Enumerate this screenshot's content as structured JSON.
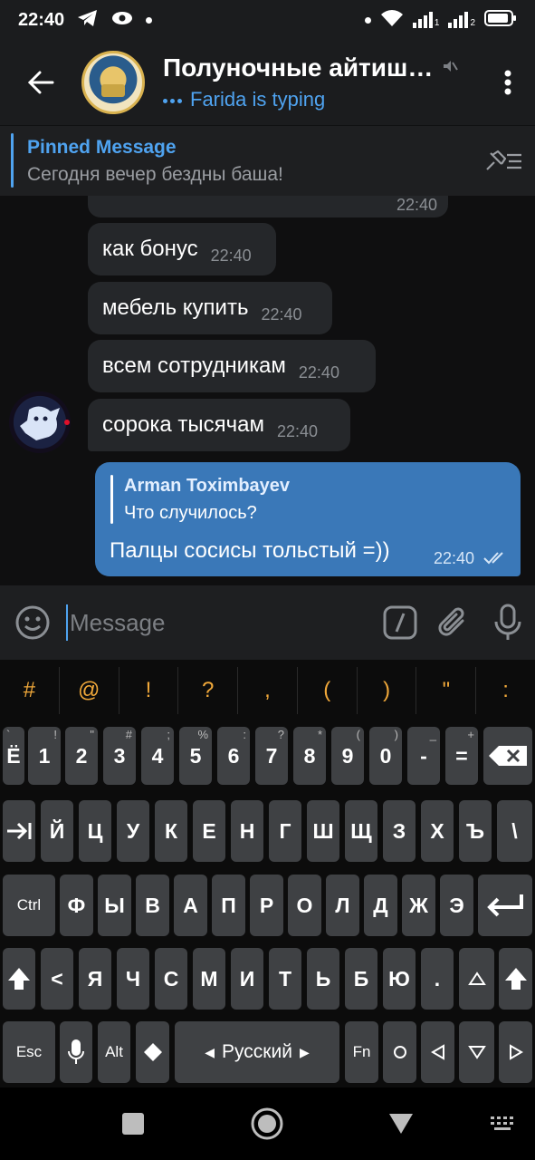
{
  "status": {
    "time": "22:40",
    "sim_labels": [
      "1",
      "2"
    ]
  },
  "header": {
    "title": "Полуночные айтиш…",
    "typing": "Farida is typing"
  },
  "pinned": {
    "label": "Pinned Message",
    "text": "Сегодня вечер бездны баша!"
  },
  "messages": {
    "incoming": [
      {
        "text": "",
        "time": "22:40"
      },
      {
        "text": "как бонус",
        "time": "22:40"
      },
      {
        "text": "мебель купить",
        "time": "22:40"
      },
      {
        "text": "всем сотрудникам",
        "time": "22:40"
      },
      {
        "text": "сорока тысячам",
        "time": "22:40"
      }
    ],
    "outgoing": {
      "reply_name": "Arman Toximbayev",
      "reply_text": "Что случилось?",
      "text": "Палцы сосисы тольстый =))",
      "time": "22:40"
    }
  },
  "composer": {
    "placeholder": "Message"
  },
  "keyboard": {
    "symbols": [
      "#",
      "@",
      "!",
      "?",
      ",",
      "(",
      ")",
      "\"",
      ":"
    ],
    "row1": [
      "Ё",
      "1",
      "2",
      "3",
      "4",
      "5",
      "6",
      "7",
      "8",
      "9",
      "0",
      "-",
      "="
    ],
    "row1_hints": [
      "`",
      "!",
      "\"",
      "#",
      ";",
      "%",
      ":",
      "?",
      "*",
      "(",
      ")",
      "_",
      "+"
    ],
    "row2": [
      "Й",
      "Ц",
      "У",
      "К",
      "Е",
      "Н",
      "Г",
      "Ш",
      "Щ",
      "З",
      "Х",
      "Ъ",
      "\\"
    ],
    "row3": [
      "Ф",
      "Ы",
      "В",
      "А",
      "П",
      "Р",
      "О",
      "Л",
      "Д",
      "Ж",
      "Э"
    ],
    "row4": [
      "<",
      "Я",
      "Ч",
      "С",
      "М",
      "И",
      "Т",
      "Ь",
      "Б",
      "Ю",
      "."
    ],
    "ctrl": "Ctrl",
    "esc": "Esc",
    "alt": "Alt",
    "fn": "Fn",
    "language": "Русский"
  }
}
